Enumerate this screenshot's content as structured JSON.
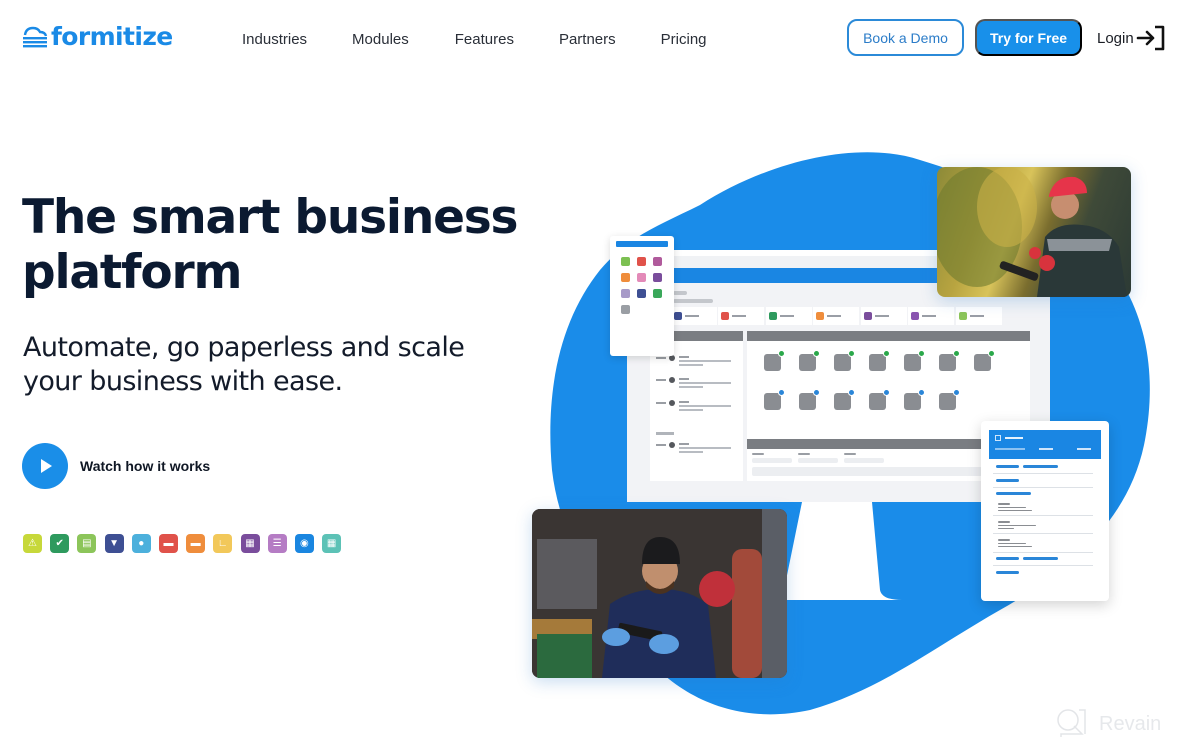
{
  "brand": {
    "name": "formitize",
    "color": "#1a8ae6"
  },
  "nav": {
    "items": [
      {
        "label": "Industries"
      },
      {
        "label": "Modules"
      },
      {
        "label": "Features"
      },
      {
        "label": "Partners"
      },
      {
        "label": "Pricing"
      }
    ]
  },
  "header_actions": {
    "book_demo": "Book a Demo",
    "try_free": "Try for Free",
    "login": "Login",
    "login_icon": "login-arrow-icon"
  },
  "hero": {
    "title_line1": "The smart business",
    "title_line2": "platform",
    "subtitle_line1": "Automate, go paperless and scale",
    "subtitle_line2": "your business with ease.",
    "watch_label": "Watch how it works",
    "play_icon": "play-icon"
  },
  "module_icons": [
    {
      "name": "warning-icon",
      "color": "#c7d83a",
      "glyph": "⚠"
    },
    {
      "name": "check-circle-icon",
      "color": "#2e9a5e",
      "glyph": "✔"
    },
    {
      "name": "document-icon",
      "color": "#8cc55a",
      "glyph": "▤"
    },
    {
      "name": "funnel-icon",
      "color": "#3e4f93",
      "glyph": "▼"
    },
    {
      "name": "user-circle-icon",
      "color": "#4cb0dc",
      "glyph": "●"
    },
    {
      "name": "briefcase-icon",
      "color": "#e0524a",
      "glyph": "▬"
    },
    {
      "name": "folder-icon",
      "color": "#ef8d3c",
      "glyph": "▬"
    },
    {
      "name": "chart-icon",
      "color": "#f2c85a",
      "glyph": "∟"
    },
    {
      "name": "calculator-icon",
      "color": "#7a4d9c",
      "glyph": "▦"
    },
    {
      "name": "team-icon",
      "color": "#b57cc4",
      "glyph": "☰"
    },
    {
      "name": "chat-bot-icon",
      "color": "#1a86e0",
      "glyph": "◉"
    },
    {
      "name": "calendar-icon",
      "color": "#5cc2b6",
      "glyph": "▦"
    }
  ],
  "illustration": {
    "blob_color": "#1a8ce9",
    "monitor_modules": [
      "#3e4f93",
      "#e0524a",
      "#2e9a5e",
      "#ef8d3c",
      "#7a4d9c",
      "#8a55b0",
      "#8cc55a"
    ],
    "monitor_apps_row1_badge": "#2aa84a",
    "monitor_apps_row2_badge": "#2a86d8",
    "tablet_icons": [
      "#7cc052",
      "#e0524a",
      "#b05a9c",
      "#ef8d3c",
      "#e38ab8",
      "#7a4d9c",
      "#a79ac8",
      "#3e4f93",
      "#3aa85a",
      "#9a9ea4"
    ],
    "photo_farmer_alt": "Farmer in red cap using tablet among plants",
    "photo_mechanic_alt": "Mechanic in beanie holding tablet in service van"
  },
  "watermark": {
    "text": "Revain"
  }
}
